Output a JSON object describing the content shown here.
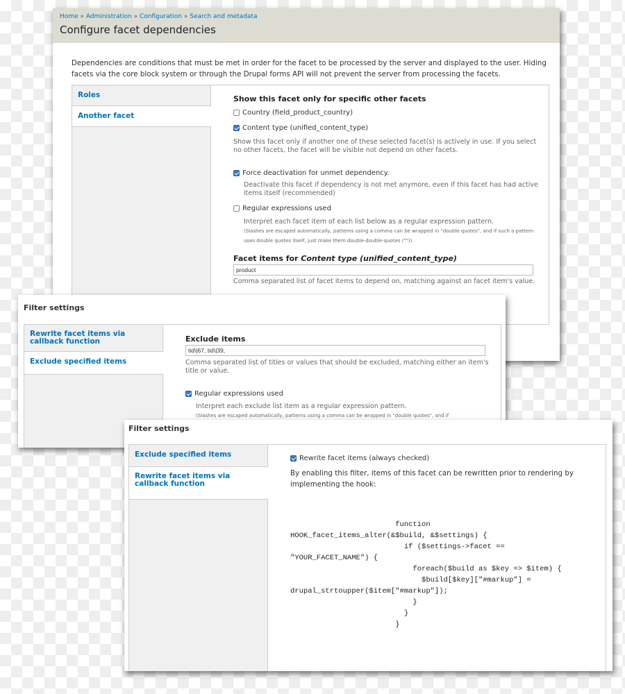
{
  "main": {
    "breadcrumb": [
      "Home",
      "Administration",
      "Configuration",
      "Search and metadata"
    ],
    "breadcrumb_sep": "»",
    "title": "Configure facet dependencies",
    "intro": "Dependencies are conditions that must be met in order for the facet to be processed by the server and displayed to the user. Hiding facets via the core block system or through the Drupal forms API will not prevent the server from processing the facets.",
    "tabs": [
      {
        "label": "Roles",
        "active": false
      },
      {
        "label": "Another facet",
        "active": true
      }
    ],
    "section_title": "Show this facet only for specific other facets",
    "facets": [
      {
        "label": "Country (field_product_country)",
        "checked": false
      },
      {
        "label": "Content type (unified_content_type)",
        "checked": true
      }
    ],
    "facets_desc": "Show this facet only if another one of these selected facet(s) is actively in use. If you select no other facets, the facet will be visible not depend on other facets.",
    "force": {
      "label": "Force deactivation for unmet dependency.",
      "checked": true,
      "desc": "Deactivate this facet if dependency is not met anymore, even if this facet has had active items itself (recommended)"
    },
    "regex": {
      "label": "Regular expressions used",
      "checked": false,
      "desc": "Interpret each facet item of each list below as a regular expression pattern.",
      "note": "(Slashes are escaped automatically, patterns using a comma can be wrapped in \"double quotes\", and if such a pattern uses double quotes itself, just make them double-double-quotes (\"\"))."
    },
    "items_label_prefix": "Facet items for ",
    "items_label_em": "Content type (unified_content_type)",
    "items_value": "product",
    "items_desc": "Comma separated list of facet items to depend on, matching against an facet item's value."
  },
  "filter1": {
    "title": "Filter settings",
    "tabs": [
      {
        "label": "Rewrite facet items via callback function",
        "active": false
      },
      {
        "label": "Exclude specified items",
        "active": true
      }
    ],
    "exclude_label": "Exclude items",
    "exclude_value": "tid\\|67, tid\\|39,",
    "exclude_desc": "Comma separated list of titles or values that should be excluded, matching either an item's title or value.",
    "regex": {
      "label": "Regular expressions used",
      "checked": true,
      "desc": "Interpret each exclude list item as a regular expression pattern.",
      "note": "(Slashes are escaped automatically, patterns using a comma can be wrapped in \"double quotes\", and if"
    }
  },
  "filter2": {
    "title": "Filter settings",
    "tabs": [
      {
        "label": "Exclude specified items",
        "active": false
      },
      {
        "label": "Rewrite facet items via callback function",
        "active": true
      }
    ],
    "rewrite": {
      "label": "Rewrite facet items (always checked)",
      "checked": true
    },
    "desc": "By enabling this filter, items of this facet can be rewritten prior to rendering by implementing the hook:",
    "code": "                        function\nHOOK_facet_items_alter(&$build, &$settings) {\n                          if ($settings->facet ==\n\"YOUR_FACET_NAME\") {\n                            foreach($build as $key => $item) {\n                              $build[$key][\"#markup\"] =\ndrupal_strtoupper($item[\"#markup\"]);\n                            }\n                          }\n                        }"
  }
}
